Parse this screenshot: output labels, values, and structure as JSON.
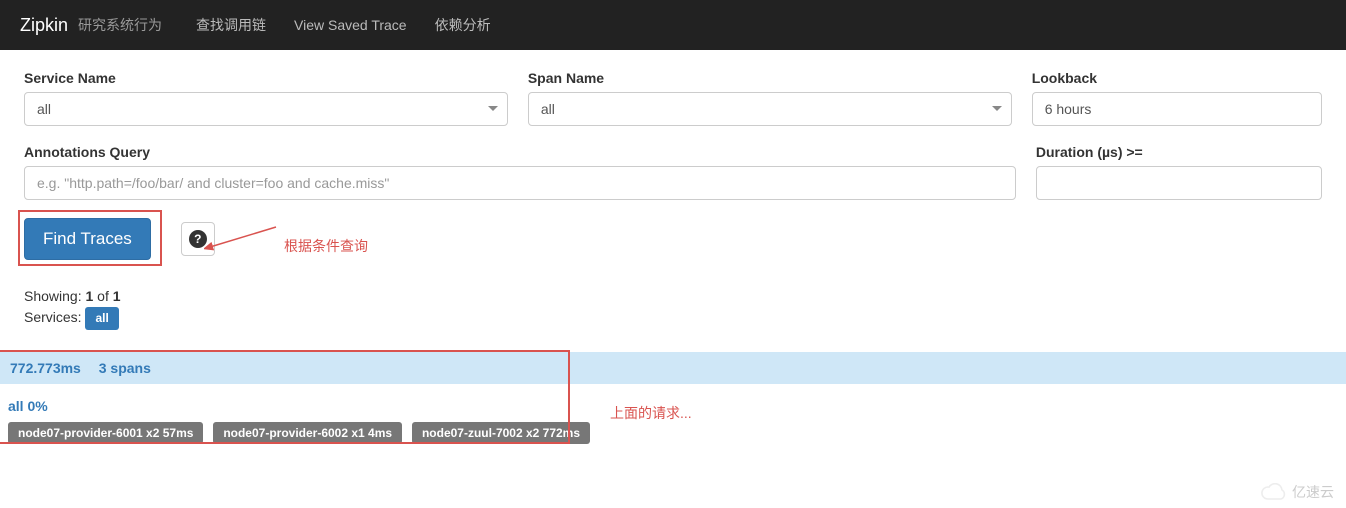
{
  "navbar": {
    "brand": "Zipkin",
    "subtitle": "研究系统行为",
    "links": {
      "find": "查找调用链",
      "saved": "View Saved Trace",
      "deps": "依赖分析"
    }
  },
  "form": {
    "service_label": "Service Name",
    "service_value": "all",
    "span_label": "Span Name",
    "span_value": "all",
    "lookback_label": "Lookback",
    "lookback_value": "6 hours",
    "anno_label": "Annotations Query",
    "anno_placeholder": "e.g. \"http.path=/foo/bar/ and cluster=foo and cache.miss\"",
    "duration_label": "Duration (µs) >=",
    "find_btn": "Find Traces",
    "help_icon": "?"
  },
  "annotations": {
    "query_hint": "根据条件查询",
    "request_hint": "上面的请求..."
  },
  "results": {
    "showing_prefix": "Showing: ",
    "showing_count": "1",
    "showing_of": " of ",
    "showing_total": "1",
    "services_prefix": "Services: ",
    "services_badge": "all"
  },
  "trace": {
    "duration": "772.773ms",
    "spans": "3 spans",
    "root": "all 0%",
    "tags": {
      "a": "node07-provider-6001 x2 57ms",
      "b": "node07-provider-6002 x1 4ms",
      "c": "node07-zuul-7002 x2 772ms"
    }
  },
  "watermark": "亿速云"
}
